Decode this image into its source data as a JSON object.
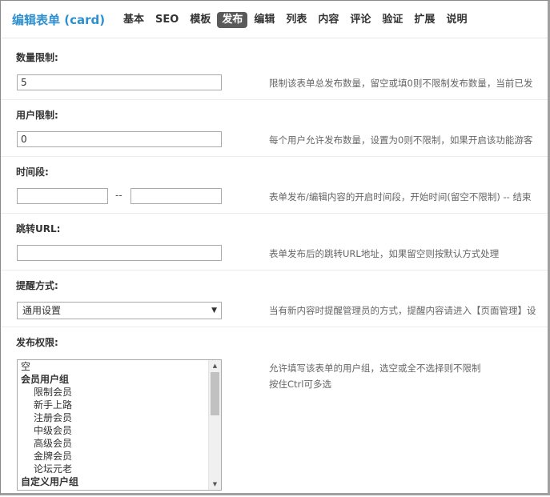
{
  "header": {
    "title": "编辑表单 (card)",
    "tabs": [
      {
        "label": "基本",
        "active": false
      },
      {
        "label": "SEO",
        "active": false
      },
      {
        "label": "模板",
        "active": false
      },
      {
        "label": "发布",
        "active": true
      },
      {
        "label": "编辑",
        "active": false
      },
      {
        "label": "列表",
        "active": false
      },
      {
        "label": "内容",
        "active": false
      },
      {
        "label": "评论",
        "active": false
      },
      {
        "label": "验证",
        "active": false
      },
      {
        "label": "扩展",
        "active": false
      },
      {
        "label": "说明",
        "active": false
      }
    ]
  },
  "form": {
    "limit": {
      "label": "数量限制:",
      "value": "5",
      "hint": "限制该表单总发布数量，留空或填0则不限制发布数量，当前已发"
    },
    "user_limit": {
      "label": "用户限制:",
      "value": "0",
      "hint": "每个用户允许发布数量，设置为0则不限制，如果开启该功能游客"
    },
    "time_range": {
      "label": "时间段:",
      "start": "",
      "separator": "--",
      "end": "",
      "hint": "表单发布/编辑内容的开启时间段，开始时间(留空不限制) -- 结束"
    },
    "redirect": {
      "label": "跳转URL:",
      "value": "",
      "hint": "表单发布后的跳转URL地址，如果留空则按默认方式处理"
    },
    "notify": {
      "label": "提醒方式:",
      "selected": "通用设置",
      "hint": "当有新内容时提醒管理员的方式，提醒内容请进入【页面管理】设"
    },
    "permission": {
      "label": "发布权限:",
      "hint_line1": "允许填写该表单的用户组，选空或全不选择则不限制",
      "hint_line2": "按住Ctrl可多选",
      "options": [
        {
          "label": "空",
          "kind": "item"
        },
        {
          "label": "会员用户组",
          "kind": "group"
        },
        {
          "label": "限制会员",
          "kind": "child"
        },
        {
          "label": "新手上路",
          "kind": "child"
        },
        {
          "label": "注册会员",
          "kind": "child"
        },
        {
          "label": "中级会员",
          "kind": "child"
        },
        {
          "label": "高级会员",
          "kind": "child"
        },
        {
          "label": "金牌会员",
          "kind": "child"
        },
        {
          "label": "论坛元老",
          "kind": "child"
        },
        {
          "label": "自定义用户组",
          "kind": "group"
        }
      ]
    }
  },
  "icons": {
    "select_arrow": "chevron-down-icon",
    "scroll_up": "scroll-up-icon",
    "scroll_down": "scroll-down-icon"
  }
}
